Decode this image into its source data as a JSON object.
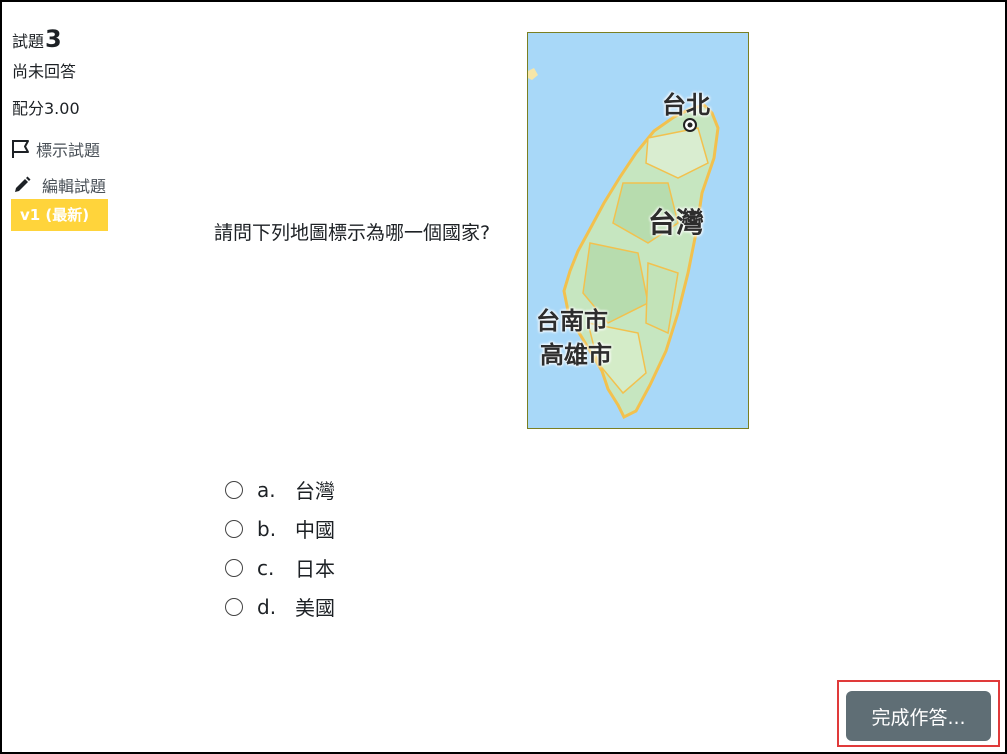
{
  "info": {
    "question_label": "試題",
    "question_number": "3",
    "state": "尚未回答",
    "grade": "配分3.00",
    "flag_label": "標示試題",
    "edit_label": "編輯試題",
    "version_badge": "v1 (最新)"
  },
  "question": {
    "text": "請問下列地圖標示為哪一個國家?",
    "map_labels": {
      "taipei": "台北",
      "taiwan": "台灣",
      "tainan": "台南市",
      "kaohsiung": "高雄市"
    },
    "options": [
      {
        "letter": "a.",
        "text": "台灣"
      },
      {
        "letter": "b.",
        "text": "中國"
      },
      {
        "letter": "c.",
        "text": "日本"
      },
      {
        "letter": "d.",
        "text": "美國"
      }
    ]
  },
  "actions": {
    "finish_label": "完成作答..."
  },
  "colors": {
    "badge": "#ffd43b",
    "finish_button": "#5f6e75",
    "highlight_outline": "#e03a3a",
    "sea": "#a8d8f8",
    "land": "#c6e6c0"
  }
}
